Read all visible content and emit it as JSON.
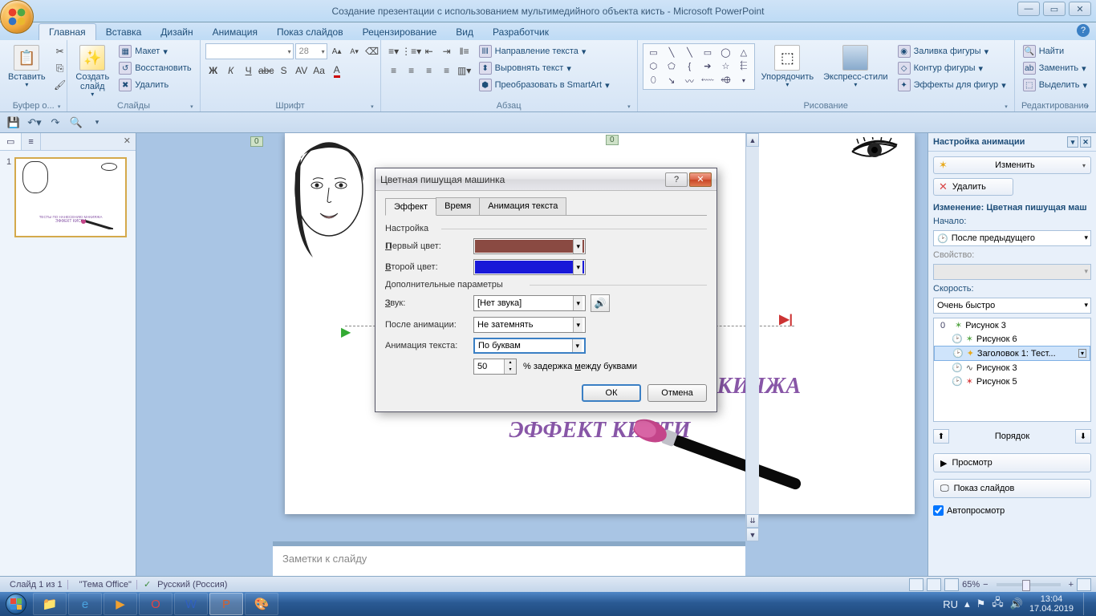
{
  "title": "Создание презентации с использованием мультимедийного объекта кисть - Microsoft PowerPoint",
  "ribbon_tabs": {
    "home": "Главная",
    "insert": "Вставка",
    "design": "Дизайн",
    "animation": "Анимация",
    "slideshow": "Показ слайдов",
    "review": "Рецензирование",
    "view": "Вид",
    "developer": "Разработчик"
  },
  "ribbon": {
    "clipboard": {
      "label": "Буфер о...",
      "paste": "Вставить"
    },
    "slides": {
      "label": "Слайды",
      "new": "Создать\nслайд",
      "layout": "Макет",
      "reset": "Восстановить",
      "delete": "Удалить"
    },
    "font": {
      "label": "Шрифт",
      "size": "28"
    },
    "paragraph": {
      "label": "Абзац",
      "direction": "Направление текста",
      "align": "Выровнять текст",
      "smartart": "Преобразовать в SmartArt"
    },
    "drawing": {
      "label": "Рисование",
      "arrange": "Упорядочить",
      "quick": "Экспресс-стили",
      "fill": "Заливка фигуры",
      "outline": "Контур фигуры",
      "effects": "Эффекты для фигур"
    },
    "editing": {
      "label": "Редактирование",
      "find": "Найти",
      "replace": "Заменить",
      "select": "Выделить"
    }
  },
  "slide_panel": {
    "tab_slides_icon": "▭",
    "tab_outline_icon": "≡",
    "num": "1"
  },
  "canvas": {
    "marker_top_left": "0",
    "marker_top_right": "0",
    "marker_title": "0",
    "title": "ТЕСТЫ  ПО НАНЕСЕНИЮ МАКИЯЖА",
    "subtitle": "ЭФФЕКТ КИСТИ",
    "thumb_title": "ТЕСТЫ  ПО НАНЕСЕНИЮ МАКИЯЖА",
    "thumb_subtitle": "ЭФФЕКТ КИСТИ"
  },
  "notes_placeholder": "Заметки к слайду",
  "anim_pane": {
    "header": "Настройка анимации",
    "change": "Изменить",
    "remove": "Удалить",
    "modify_label": "Изменение: Цветная пишущая маш",
    "start_label": "Начало:",
    "start_value": "После предыдущего",
    "property_label": "Свойство:",
    "speed_label": "Скорость:",
    "speed_value": "Очень быстро",
    "items": [
      {
        "num": "0",
        "clock": "",
        "icon": "✶",
        "color": "#5aa84a",
        "text": "Рисунок 3"
      },
      {
        "num": "",
        "clock": "🕑",
        "icon": "✶",
        "color": "#5aa84a",
        "text": "Рисунок 6"
      },
      {
        "num": "",
        "clock": "🕑",
        "icon": "✦",
        "color": "#e8a818",
        "text": "Заголовок 1: Тест..."
      },
      {
        "num": "",
        "clock": "🕑",
        "icon": "∿",
        "color": "#555",
        "text": "Рисунок 3"
      },
      {
        "num": "",
        "clock": "🕑",
        "icon": "✶",
        "color": "#d94545",
        "text": "Рисунок 5"
      }
    ],
    "reorder": "Порядок",
    "preview": "Просмотр",
    "slideshow": "Показ слайдов",
    "autopreview": "Автопросмотр"
  },
  "dialog": {
    "title": "Цветная пишущая машинка",
    "tabs": {
      "effect": "Эффект",
      "timing": "Время",
      "text": "Анимация текста"
    },
    "settings": "Настройка",
    "first_color_label": "Первый цвет:",
    "first_color": "#8a4a42",
    "second_color_label": "Второй цвет:",
    "second_color": "#1818d8",
    "extra": "Дополнительные параметры",
    "sound_label": "Звук:",
    "sound_value": "[Нет звука]",
    "after_label": "После анимации:",
    "after_value": "Не затемнять",
    "textanim_label": "Анимация текста:",
    "textanim_value": "По буквам",
    "delay_value": "50",
    "delay_suffix": "% задержка между буквами",
    "ok": "ОК",
    "cancel": "Отмена"
  },
  "statusbar": {
    "slide": "Слайд 1 из 1",
    "theme": "\"Тема Office\"",
    "lang": "Русский (Россия)",
    "zoom": "65%"
  },
  "taskbar": {
    "lang": "RU",
    "time": "13:04",
    "date": "17.04.2019"
  }
}
